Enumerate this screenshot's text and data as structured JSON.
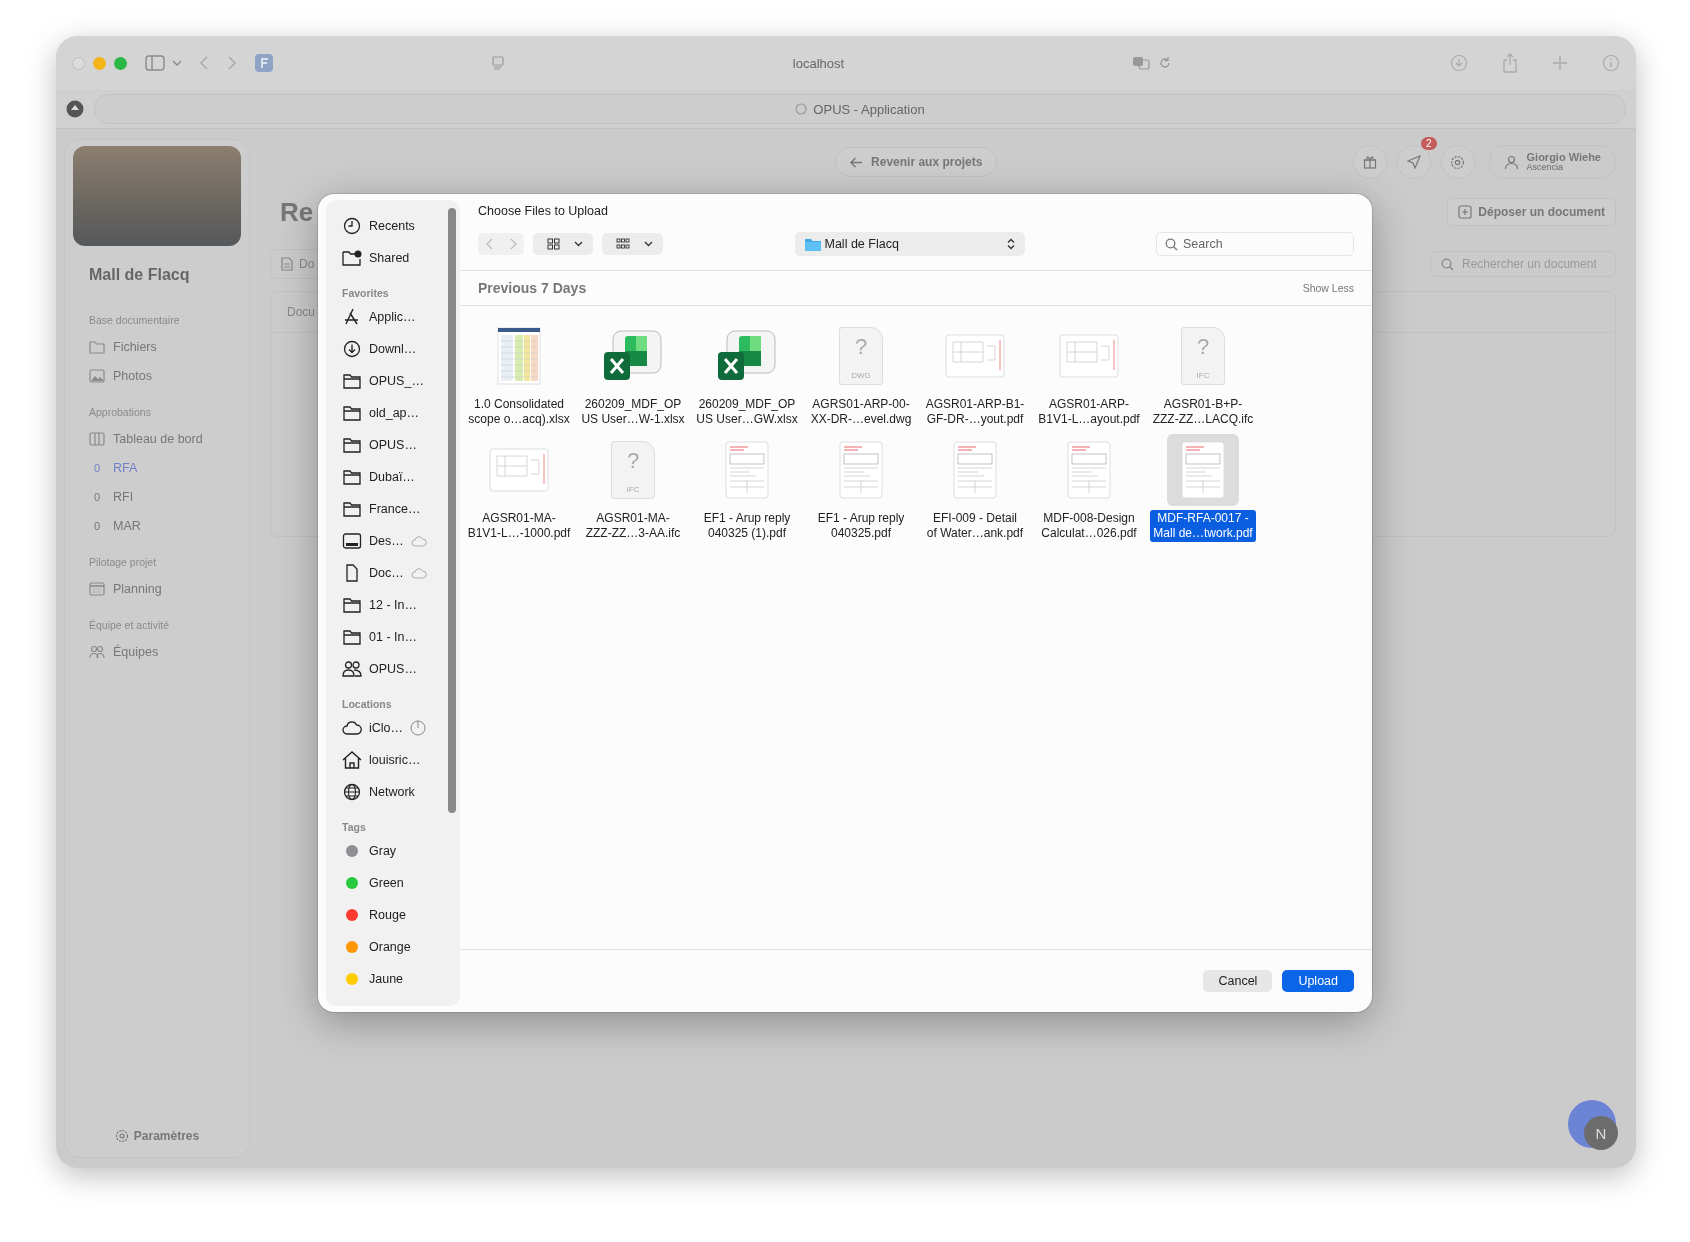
{
  "browser": {
    "url": "localhost",
    "tab_title": "OPUS - Application"
  },
  "app_sidebar": {
    "project_name": "Mall de Flacq",
    "sections": [
      {
        "title": "Base documentaire",
        "items": [
          {
            "label": "Fichiers",
            "kind": "folder",
            "selected": false
          },
          {
            "label": "Photos",
            "kind": "photo",
            "selected": false
          }
        ]
      },
      {
        "title": "Approbations",
        "items": [
          {
            "label": "Tableau de bord",
            "kind": "board",
            "selected": false
          },
          {
            "label": "RFA",
            "kind": "count",
            "count": "0",
            "selected": true
          },
          {
            "label": "RFI",
            "kind": "count",
            "count": "0",
            "selected": false
          },
          {
            "label": "MAR",
            "kind": "count",
            "count": "0",
            "selected": false
          }
        ]
      },
      {
        "title": "Pilotage projet",
        "items": [
          {
            "label": "Planning",
            "kind": "calendar",
            "selected": false
          }
        ]
      },
      {
        "title": "Équipe et activité",
        "items": [
          {
            "label": "Équipes",
            "kind": "people",
            "selected": false
          }
        ]
      }
    ],
    "settings": "Paramètres"
  },
  "header": {
    "back_button": "Revenir aux projets",
    "notification_count": "2",
    "user_name": "Giorgio Wiehe",
    "user_org": "Ascencia",
    "page_title": "Re",
    "upload_button": "Déposer un document",
    "tab": "Do",
    "search_placeholder": "Rechercher un document",
    "table_header": "Docu"
  },
  "avatar_initial": "N",
  "dialog": {
    "title": "Choose Files to Upload",
    "location": "Mall de Flacq",
    "search_placeholder": "Search",
    "section_title": "Previous 7 Days",
    "show_less": "Show Less",
    "sidebar": [
      {
        "items": [
          {
            "label": "Recents",
            "kind": "clock"
          },
          {
            "label": "Shared",
            "kind": "shared"
          }
        ]
      },
      {
        "title": "Favorites",
        "items": [
          {
            "label": "Applic…",
            "kind": "apps",
            "in_cloud": false
          },
          {
            "label": "Downl…",
            "kind": "download",
            "in_cloud": false
          },
          {
            "label": "OPUS_…",
            "kind": "folder",
            "in_cloud": false
          },
          {
            "label": "old_ap…",
            "kind": "folder",
            "in_cloud": false
          },
          {
            "label": "OPUS…",
            "kind": "folder",
            "in_cloud": false
          },
          {
            "label": "Dubaï…",
            "kind": "folder",
            "in_cloud": false
          },
          {
            "label": "France…",
            "kind": "folder",
            "in_cloud": false
          },
          {
            "label": "Des…",
            "kind": "desktop",
            "in_cloud": true
          },
          {
            "label": "Doc…",
            "kind": "document",
            "in_cloud": true
          },
          {
            "label": "12 - In…",
            "kind": "folder",
            "in_cloud": false
          },
          {
            "label": "01 - In…",
            "kind": "folder",
            "in_cloud": false
          },
          {
            "label": "OPUS…",
            "kind": "people",
            "in_cloud": false
          }
        ]
      },
      {
        "title": "Locations",
        "items": [
          {
            "label": "iClo…",
            "kind": "cloud",
            "syncing": true
          },
          {
            "label": "louisric…",
            "kind": "home",
            "syncing": false
          },
          {
            "label": "Network",
            "kind": "globe",
            "syncing": false
          }
        ]
      },
      {
        "title": "Tags",
        "items": [
          {
            "label": "Gray",
            "kind": "tag",
            "color": "#8e8e93"
          },
          {
            "label": "Green",
            "kind": "tag",
            "color": "#28c840"
          },
          {
            "label": "Rouge",
            "kind": "tag",
            "color": "#ff3b30"
          },
          {
            "label": "Orange",
            "kind": "tag",
            "color": "#ff9500"
          },
          {
            "label": "Jaune",
            "kind": "tag",
            "color": "#ffcc00"
          }
        ]
      }
    ],
    "files": [
      {
        "name_lines": [
          "1.0 Consolidated",
          "scope o…acq).xlsx"
        ],
        "kind": "sheet",
        "selected": false
      },
      {
        "name_lines": [
          "260209_MDF_OP",
          "US User…W-1.xlsx"
        ],
        "kind": "excel",
        "selected": false
      },
      {
        "name_lines": [
          "260209_MDF_OP",
          "US User…GW.xlsx"
        ],
        "kind": "excel",
        "selected": false
      },
      {
        "name_lines": [
          "AGRS01-ARP-00-",
          "XX-DR-…evel.dwg"
        ],
        "kind": "unknown",
        "glyph": "?",
        "type_label": "DWG",
        "selected": false
      },
      {
        "name_lines": [
          "AGSR01-ARP-B1-",
          "GF-DR-…yout.pdf"
        ],
        "kind": "plan",
        "selected": false
      },
      {
        "name_lines": [
          "AGSR01-ARP-",
          "B1V1-L…ayout.pdf"
        ],
        "kind": "plan",
        "selected": false
      },
      {
        "name_lines": [
          "AGSR01-B+P-",
          "ZZZ-ZZ…LACQ.ifc"
        ],
        "kind": "unknown",
        "glyph": "?",
        "type_label": "IFC",
        "selected": false
      },
      {
        "name_lines": [
          "AGSR01-MA-",
          "B1V1-L…-1000.pdf"
        ],
        "kind": "plan",
        "selected": false
      },
      {
        "name_lines": [
          "AGSR01-MA-",
          "ZZZ-ZZ…3-AA.ifc"
        ],
        "kind": "unknown",
        "glyph": "?",
        "type_label": "IFC",
        "selected": false
      },
      {
        "name_lines": [
          "EF1 - Arup reply",
          "040325 (1).pdf"
        ],
        "kind": "pdf",
        "selected": false
      },
      {
        "name_lines": [
          "EF1 - Arup reply",
          "040325.pdf"
        ],
        "kind": "pdf",
        "selected": false
      },
      {
        "name_lines": [
          "EFI-009 - Detail",
          "of Water…ank.pdf"
        ],
        "kind": "pdf",
        "selected": false
      },
      {
        "name_lines": [
          "MDF-008-Design",
          "Calculat…026.pdf"
        ],
        "kind": "pdf",
        "selected": false
      },
      {
        "name_lines": [
          "MDF-RFA-0017 -",
          "Mall de…twork.pdf"
        ],
        "kind": "pdf",
        "selected": true
      }
    ],
    "buttons": [
      {
        "label": "Cancel",
        "kind": "secondary"
      },
      {
        "label": "Upload",
        "kind": "primary"
      }
    ]
  }
}
